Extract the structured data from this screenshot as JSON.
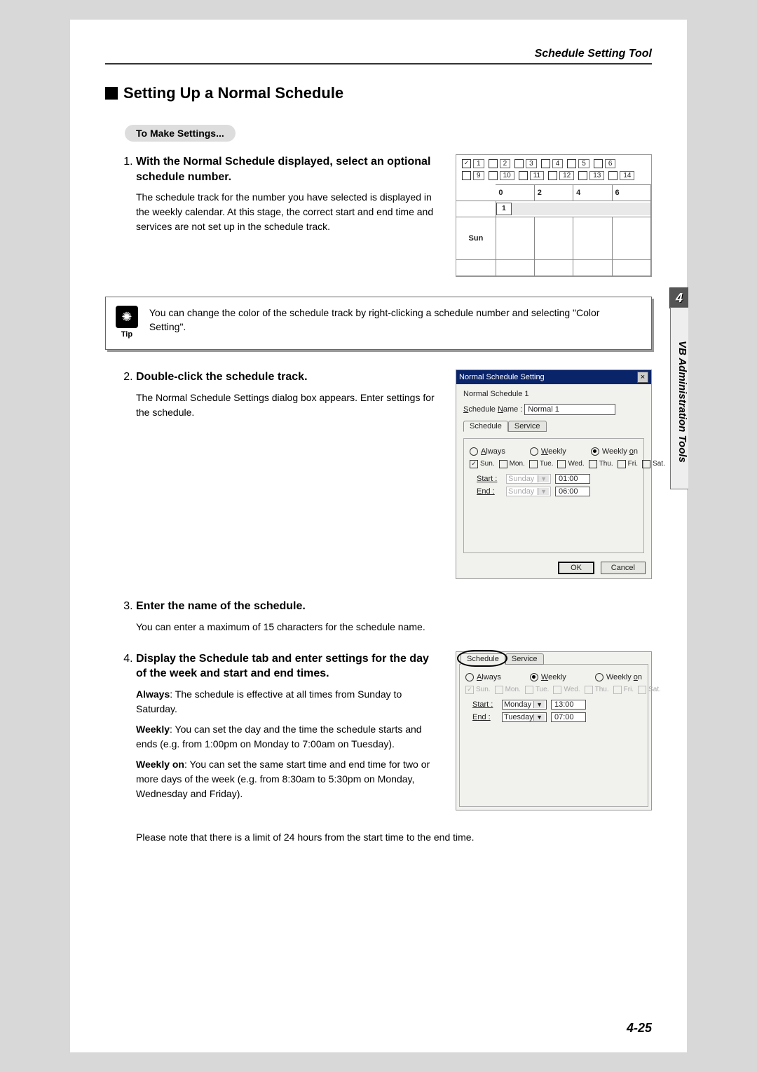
{
  "header": {
    "tool_title": "Schedule Setting Tool"
  },
  "h1": "Setting Up a Normal Schedule",
  "pill": "To Make Settings...",
  "side": {
    "chapter": "4",
    "label": "VB Administration Tools"
  },
  "pagenum": "4-25",
  "step1": {
    "head": "With the Normal Schedule displayed, select an optional schedule number.",
    "body": "The schedule track for the number you have selected is displayed in the weekly calendar. At this stage, the correct start and end time and services are not set up in the schedule track."
  },
  "fig1": {
    "row1": [
      "1",
      "2",
      "3",
      "4",
      "5",
      "6"
    ],
    "row2": [
      "9",
      "10",
      "11",
      "12",
      "13",
      "14"
    ],
    "hours": [
      "0",
      "2",
      "4",
      "6"
    ],
    "day": "Sun",
    "mini": "1"
  },
  "tip": {
    "label": "Tip",
    "text": "You can change the color of the schedule track by right-clicking a schedule number and selecting \"Color Setting\"."
  },
  "step2": {
    "head": "Double-click the schedule track.",
    "body": "The Normal Schedule Settings dialog box appears. Enter settings for the schedule."
  },
  "fig2": {
    "title": "Normal Schedule Setting",
    "group": "Normal Schedule 1",
    "name_lbl": "Schedule Name :",
    "name_val": "Normal 1",
    "tab1": "Schedule",
    "tab2": "Service",
    "radio_always": "Always",
    "radio_weekly": "Weekly",
    "radio_weekly_on": "Weekly on",
    "days": [
      "Sun.",
      "Mon.",
      "Tue.",
      "Wed.",
      "Thu.",
      "Fri.",
      "Sat."
    ],
    "start_lbl": "Start :",
    "end_lbl": "End :",
    "start_day": "Sunday",
    "end_day": "Sunday",
    "start_time": "01:00",
    "end_time": "06:00",
    "ok": "OK",
    "cancel": "Cancel"
  },
  "step3": {
    "head": "Enter the name of the schedule.",
    "body": "You can enter a maximum of 15 characters for the schedule name."
  },
  "step4": {
    "head": "Display the Schedule tab and enter settings for the day of the week and start and end times.",
    "always_lbl": "Always",
    "always_txt": ": The schedule is effective at all times from Sunday to Saturday.",
    "weekly_lbl": "Weekly",
    "weekly_txt": ": You can set the day and the time the schedule starts and ends (e.g. from 1:00pm on Monday to 7:00am on Tuesday).",
    "weeklyon_lbl": "Weekly on",
    "weeklyon_txt": ": You can set the same start time and end time for two or more days of the week (e.g. from 8:30am to 5:30pm on Monday, Wednesday and Friday).",
    "note": "Please note that there is a limit of 24 hours from the start time to the end time."
  },
  "fig3": {
    "tab1": "Schedule",
    "tab2": "Service",
    "radio_always": "Always",
    "radio_weekly": "Weekly",
    "radio_weekly_on": "Weekly on",
    "days": [
      "Sun.",
      "Mon.",
      "Tue.",
      "Wed.",
      "Thu.",
      "Fri.",
      "Sat."
    ],
    "start_lbl": "Start :",
    "end_lbl": "End :",
    "start_day": "Monday",
    "end_day": "Tuesday",
    "start_time": "13:00",
    "end_time": "07:00"
  }
}
